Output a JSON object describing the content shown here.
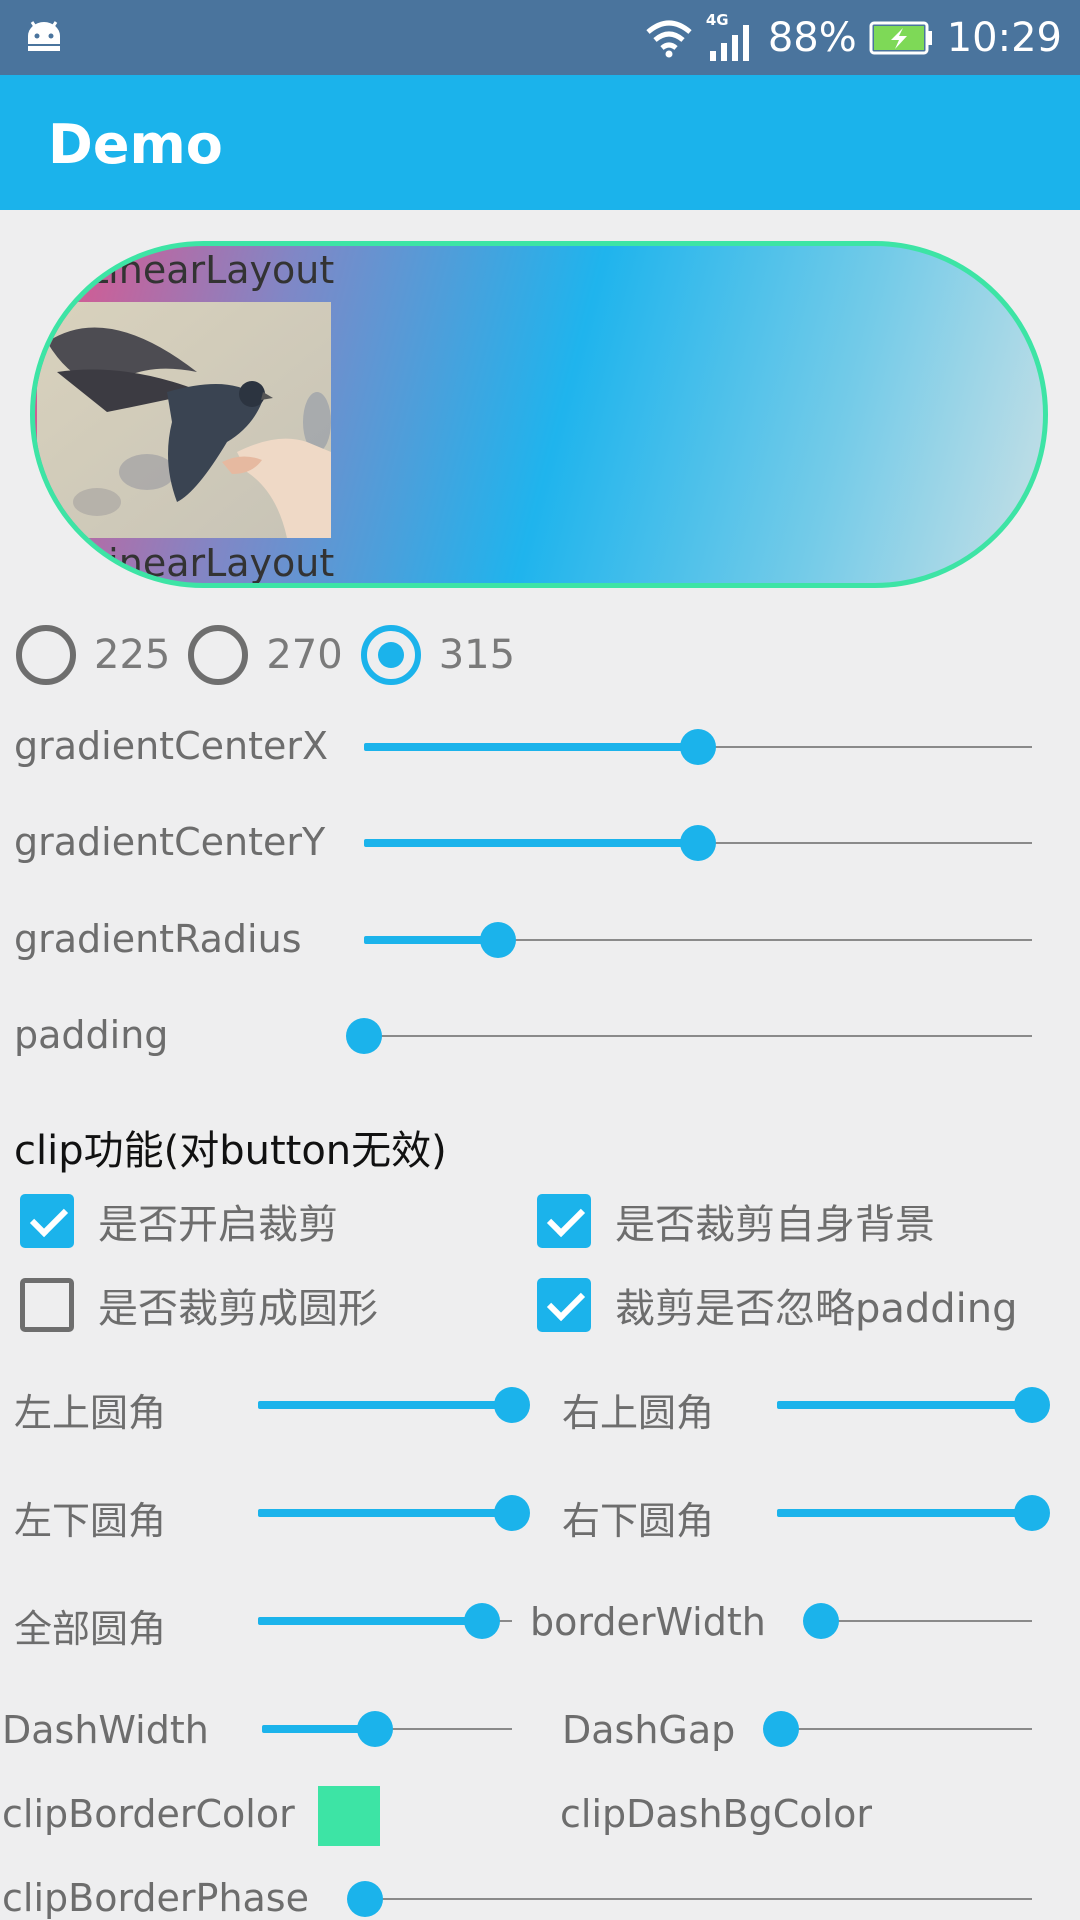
{
  "status_bar": {
    "network": "4G",
    "battery": "88%",
    "time": "10:29"
  },
  "app_bar": {
    "title": "Demo"
  },
  "demo_view": {
    "label_top": "LinearLayout",
    "label_bottom": "LinearLayout",
    "border_color": "#3de4a5"
  },
  "angle_options": [
    {
      "label": "225",
      "selected": false
    },
    {
      "label": "270",
      "selected": false
    },
    {
      "label": "315",
      "selected": true
    }
  ],
  "sliders": {
    "gradientCenterX": {
      "label": "gradientCenterX",
      "value": 0.5
    },
    "gradientCenterY": {
      "label": "gradientCenterY",
      "value": 0.5
    },
    "gradientRadius": {
      "label": "gradientRadius",
      "value": 0.2
    },
    "padding": {
      "label": "padding",
      "value": 0.0
    }
  },
  "clip_section": {
    "title": "clip功能(对button无效)",
    "checkboxes": {
      "enable_clip": {
        "label": "是否开启裁剪",
        "checked": true
      },
      "clip_own_background": {
        "label": "是否裁剪自身背景",
        "checked": true
      },
      "clip_circle": {
        "label": "是否裁剪成圆形",
        "checked": false
      },
      "ignore_padding": {
        "label": "裁剪是否忽略padding",
        "checked": true
      }
    }
  },
  "corner_sliders": {
    "top_left": {
      "label": "左上圆角",
      "value": 1.0
    },
    "top_right": {
      "label": "右上圆角",
      "value": 1.0
    },
    "bottom_left": {
      "label": "左下圆角",
      "value": 1.0
    },
    "bottom_right": {
      "label": "右下圆角",
      "value": 1.0
    },
    "all": {
      "label": "全部圆角",
      "value": 0.88
    },
    "border_width": {
      "label": "borderWidth",
      "value": 0.0
    }
  },
  "dash_sliders": {
    "dash_width": {
      "label": "DashWidth",
      "value": 0.45
    },
    "dash_gap": {
      "label": "DashGap",
      "value": 0.0
    }
  },
  "colors": {
    "clip_border_color": {
      "label": "clipBorderColor",
      "value": "#3de4a5"
    },
    "clip_dash_bg_color": {
      "label": "clipDashBgColor"
    }
  },
  "clip_border_phase": {
    "label": "clipBorderPhase",
    "value": 0.0
  },
  "accent_color": "#1bb3eb"
}
